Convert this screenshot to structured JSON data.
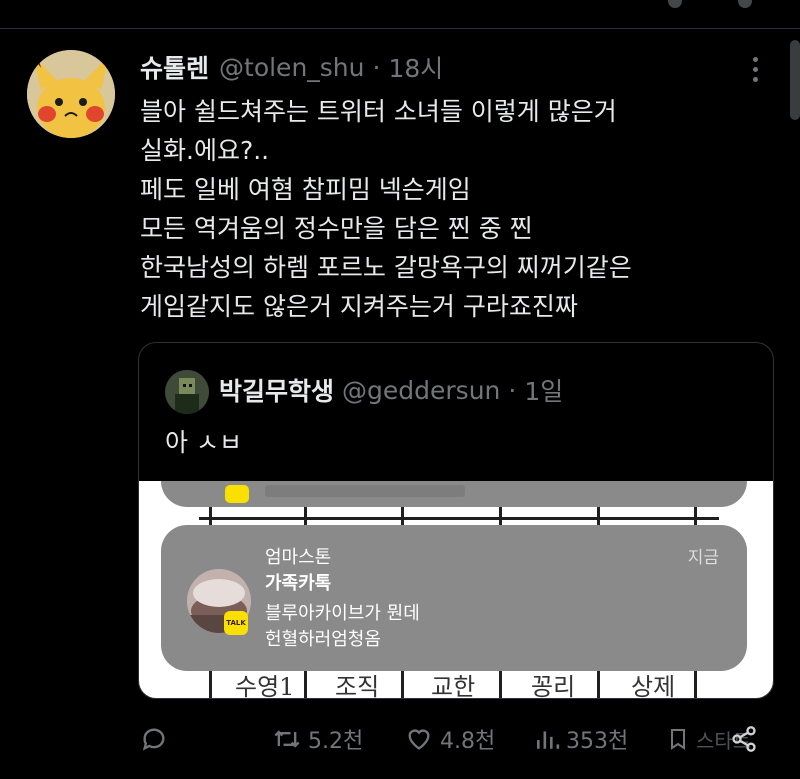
{
  "tweet": {
    "display_name": "슈톨렌",
    "handle": "@tolen_shu",
    "separator": "·",
    "time": "18시",
    "lines": [
      "블아 쉴드쳐주는 트위터 소녀들 이렇게 많은거",
      "실화.에요?..",
      "페도 일베 여혐 참피밈 넥슨게임",
      "모든 역겨움의 정수만을 담은 찐 중 찐",
      "한국남성의 하렘 포르노 갈망욕구의 찌꺼기같은",
      "게임같지도 않은거 지켜주는거 구라죠진짜"
    ]
  },
  "quote": {
    "display_name": "박길무학생",
    "handle": "@geddersun",
    "separator": "·",
    "time": "1일",
    "text": "아 ㅅㅂ",
    "notification": {
      "sender": "엄마스톤",
      "app": "가족카톡",
      "message_line1": "블루아카이브가 뭔데",
      "message_line2": "헌혈하러엄청옴",
      "time": "지금",
      "badge": "TALK"
    },
    "handwriting": [
      "수영1",
      "조직",
      "교한",
      "꽁리",
      "상제"
    ]
  },
  "actions": {
    "reply_icon": "speech-bubble-icon",
    "retweets": "5.2천",
    "likes": "4.8천",
    "views": "353천",
    "share_overlay": "스타트"
  },
  "colors": {
    "background": "#000000",
    "text": "#e7e9ea",
    "muted": "#71767b",
    "border": "#2f3336",
    "kakao_yellow": "#f9e000",
    "notification_bg": "#8a8a8a"
  }
}
